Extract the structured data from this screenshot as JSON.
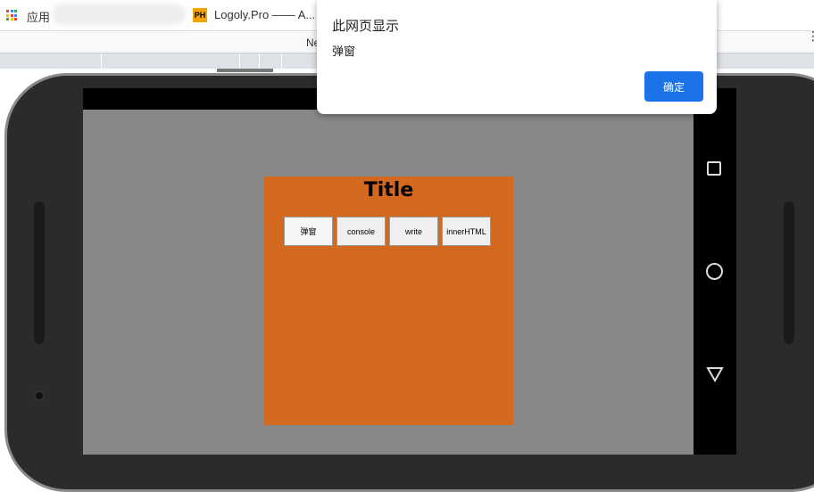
{
  "bookmarks": {
    "apps_label": "应用",
    "item": "Logoly.Pro —— A...",
    "item_icon": "PH"
  },
  "toolbar": {
    "partial_text": "Ne"
  },
  "page": {
    "title": "Title",
    "buttons": [
      "弹窗",
      "console",
      "write",
      "innerHTML"
    ]
  },
  "dialog": {
    "heading": "此网页显示",
    "message": "弹窗",
    "ok_label": "确定"
  },
  "colors": {
    "accent": "#1a73e8",
    "box": "#d2691e",
    "screen_bg": "#888888"
  }
}
